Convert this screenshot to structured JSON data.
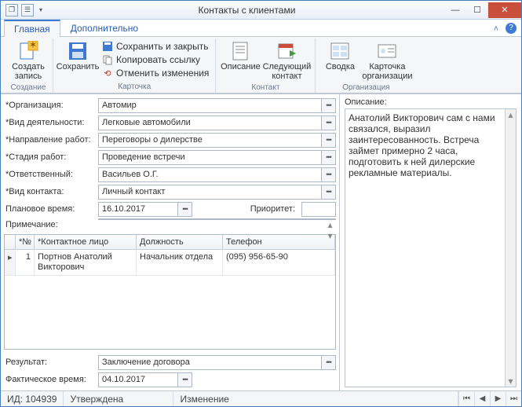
{
  "window": {
    "title": "Контакты с клиентами"
  },
  "tabs": {
    "main": "Главная",
    "extra": "Дополнительно"
  },
  "ribbon": {
    "create": {
      "label": "Создать\nзапись",
      "group": "Создание"
    },
    "save": {
      "label": "Сохранить"
    },
    "save_close": "Сохранить и закрыть",
    "copy_link": "Копировать ссылку",
    "undo": "Отменить изменения",
    "card_group": "Карточка",
    "description": {
      "label": "Описание"
    },
    "next_contact": {
      "label": "Следующий\nконтакт"
    },
    "contact_group": "Контакт",
    "summary": {
      "label": "Сводка"
    },
    "org_card": {
      "label": "Карточка\nорганизации"
    },
    "org_group": "Организация"
  },
  "fields": {
    "org": {
      "label": "*Организация:",
      "value": "Автомир"
    },
    "activity": {
      "label": "*Вид деятельности:",
      "value": "Легковые автомобили"
    },
    "direction": {
      "label": "*Направление работ:",
      "value": "Переговоры о дилерстве"
    },
    "stage": {
      "label": "*Стадия работ:",
      "value": "Проведение встречи"
    },
    "responsible": {
      "label": "*Ответственный:",
      "value": "Васильев О.Г."
    },
    "kind": {
      "label": "*Вид контакта:",
      "value": "Личный контакт"
    },
    "plan_time": {
      "label": "Плановое время:",
      "value": "16.10.2017"
    },
    "priority": {
      "label": "Приоритет:",
      "value": ""
    },
    "note": {
      "label": "Примечание:",
      "value": ""
    },
    "result": {
      "label": "Результат:",
      "value": "Заключение договора"
    },
    "fact_time": {
      "label": "Фактическое время:",
      "value": "04.10.2017"
    }
  },
  "grid": {
    "cols": {
      "n": "*№",
      "name": "*Контактное лицо",
      "pos": "Должность",
      "tel": "Телефон"
    },
    "rows": [
      {
        "n": "1",
        "name": "Портнов Анатолий Викторович",
        "pos": "Начальник отдела",
        "tel": "(095) 956-65-90"
      }
    ]
  },
  "right": {
    "label": "Описание:",
    "text": "Анатолий Викторович сам с нами связался, выразил заинтересованность. Встреча займет примерно 2 часа, подготовить к ней дилерские рекламные материалы."
  },
  "status": {
    "id_label": "ИД: 104939",
    "state": "Утверждена",
    "change": "Изменение"
  }
}
